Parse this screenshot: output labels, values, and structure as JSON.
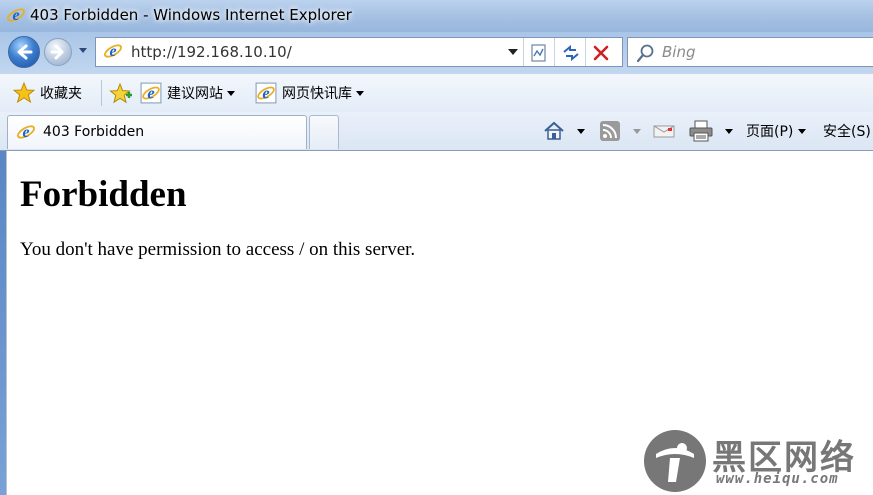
{
  "window": {
    "title": "403 Forbidden - Windows Internet Explorer"
  },
  "navigation": {
    "back_icon": "arrow-left-icon",
    "forward_icon": "arrow-right-icon",
    "address": "http://192.168.10.10/",
    "search_placeholder": "Bing"
  },
  "favorites": {
    "favorites_label": "收藏夹",
    "items": [
      {
        "label": "建议网站"
      },
      {
        "label": "网页快讯库"
      }
    ]
  },
  "tabs": [
    {
      "title": "403 Forbidden"
    }
  ],
  "command_bar": {
    "page_label": "页面(P)",
    "safety_label": "安全(S)"
  },
  "page": {
    "heading": "Forbidden",
    "message": "You don't have permission to access / on this server."
  },
  "watermark": {
    "text": "黑区网络",
    "url": "www.heiqu.com"
  },
  "colors": {
    "titlebar": "#a6c1e3",
    "ie_blue": "#1e63c8",
    "stop_red": "#d02020"
  }
}
